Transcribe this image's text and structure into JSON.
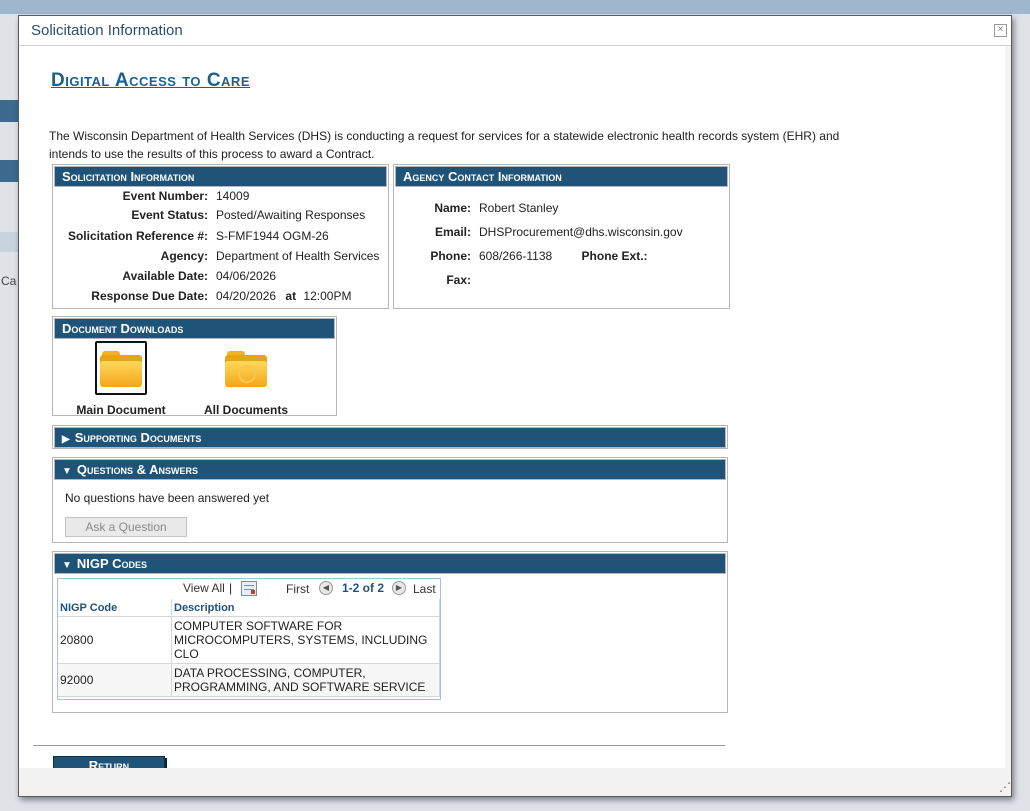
{
  "background": {
    "partial_text": "Ca"
  },
  "modal": {
    "title": "Solicitation Information",
    "close": "×",
    "resize": "⋰"
  },
  "page": {
    "heading": "Digital Access to Care",
    "intro": "The Wisconsin Department of Health Services (DHS) is conducting a request for services for a statewide electronic health records system (EHR) and intends to use the results of this process to award a Contract."
  },
  "solicitation": {
    "title": "Solicitation Information",
    "fields": [
      {
        "label": "Event Number:",
        "value": "14009"
      },
      {
        "label": "Event Status:",
        "value": "Posted/Awaiting Responses"
      },
      {
        "label": "Solicitation Reference #:",
        "value": "S-FMF1944 OGM-26"
      },
      {
        "label": "Agency:",
        "value": "Department of Health Services"
      },
      {
        "label": "Available Date:",
        "value": "04/06/2026"
      },
      {
        "label": "Response Due Date:",
        "value": "04/20/2026"
      }
    ],
    "due_at_label": "at",
    "due_time": "12:00PM"
  },
  "contact": {
    "title": "Agency Contact Information",
    "name_label": "Name:",
    "name": "Robert Stanley",
    "email_label": "Email:",
    "email": "DHSProcurement@dhs.wisconsin.gov",
    "phone_label": "Phone:",
    "phone": "608/266-1138",
    "phone_ext_label": "Phone Ext.:",
    "fax_label": "Fax:"
  },
  "downloads": {
    "title": "Document Downloads",
    "main_label": "Main Document",
    "all_label": "All Documents"
  },
  "supporting": {
    "title": "Supporting Documents",
    "toggle": "▶"
  },
  "qa": {
    "title": "Questions & Answers",
    "toggle": "▼",
    "empty_text": "No questions have been answered yet",
    "ask_button": "Ask a Question"
  },
  "nigp": {
    "title": "NIGP Codes",
    "toggle": "▼",
    "view_all": "View All",
    "pipe": "|",
    "first": "First",
    "range": "1-2 of 2",
    "last": "Last",
    "prev": "◀",
    "next": "▶",
    "columns": [
      "NIGP Code",
      "Description"
    ],
    "rows": [
      {
        "code": "20800",
        "description": "COMPUTER SOFTWARE FOR MICROCOMPUTERS, SYSTEMS, INCLUDING CLO"
      },
      {
        "code": "92000",
        "description": "DATA PROCESSING, COMPUTER, PROGRAMMING, AND SOFTWARE SERVICE"
      }
    ]
  },
  "footer": {
    "return_button": "Return"
  },
  "colors": {
    "header_blue": "#1f5478",
    "title_blue": "#1f5f8b",
    "folder_gold": "#f4a51a"
  }
}
